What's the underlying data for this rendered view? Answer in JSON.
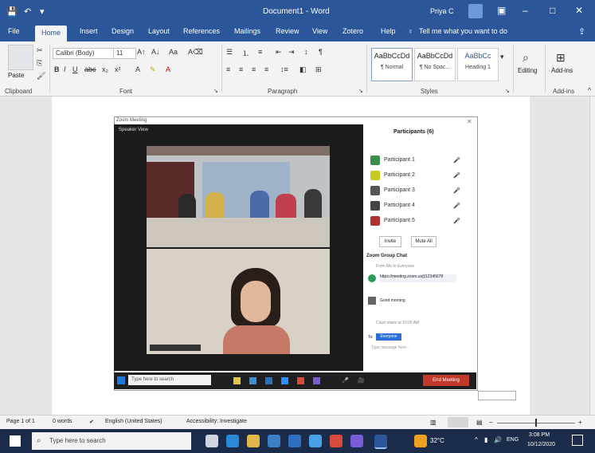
{
  "title_bar": {
    "doc_title": "Document1 - Word",
    "account": "Priya C",
    "colors": {
      "word_blue": "#2b579a"
    }
  },
  "tabs": [
    {
      "label": "File"
    },
    {
      "label": "Home"
    },
    {
      "label": "Insert"
    },
    {
      "label": "Design"
    },
    {
      "label": "Layout"
    },
    {
      "label": "References"
    },
    {
      "label": "Mailings"
    },
    {
      "label": "Review"
    },
    {
      "label": "View"
    },
    {
      "label": "Zotero"
    },
    {
      "label": "Help"
    }
  ],
  "tell_me": "Tell me what you want to do",
  "ribbon": {
    "clipboard": {
      "paste": "Paste",
      "label": "Clipboard"
    },
    "font": {
      "name": "Calibri (Body)",
      "size": "11",
      "label": "Font"
    },
    "paragraph": {
      "label": "Paragraph"
    },
    "styles": {
      "label": "Styles",
      "cards": [
        {
          "sample": "AaBbCcDd",
          "name": "¶ Normal"
        },
        {
          "sample": "AaBbCcDd",
          "name": "¶ No Spac..."
        },
        {
          "sample": "AaBbCc",
          "name": "Heading 1"
        }
      ]
    },
    "editing": {
      "label": "Editing"
    },
    "addins": {
      "label": "Add-ins",
      "name": "Add-ins"
    }
  },
  "zoom_window": {
    "title": "Zoom Meeting",
    "view_label": "Speaker View"
  },
  "panel": {
    "title": "Participants (6)",
    "participants": [
      {
        "name": "Participant 1",
        "color": "#3a8f4a"
      },
      {
        "name": "Participant 2",
        "color": "#c8c820"
      },
      {
        "name": "Participant 3",
        "color": "#555555"
      },
      {
        "name": "Participant 4",
        "color": "#444444"
      },
      {
        "name": "Participant 5",
        "color": "#b03030"
      }
    ],
    "invite": "Invite",
    "mute_all": "Mute All",
    "chat_title": "Zoom Group Chat",
    "chat_sender": "From Me to Everyone",
    "chat_messages": [
      "https://meeting.zoom.us/j/12345678",
      "Good morning",
      "Class starts at 10:00 AM"
    ],
    "to_label": "To:",
    "to_value": "Everyone",
    "input_placeholder": "Type message here..."
  },
  "meeting_bar": {
    "search": "Type here to search",
    "leave": "End Meeting"
  },
  "statusbar": {
    "page": "Page 1 of 1",
    "words": "0 words",
    "language": "English (United States)",
    "accessibility": "Accessibility: Investigate"
  },
  "taskbar": {
    "search": "Type here to search",
    "lang": "ENG",
    "time": "3:08 PM",
    "date": "10/12/2020",
    "temp": "32°C"
  }
}
